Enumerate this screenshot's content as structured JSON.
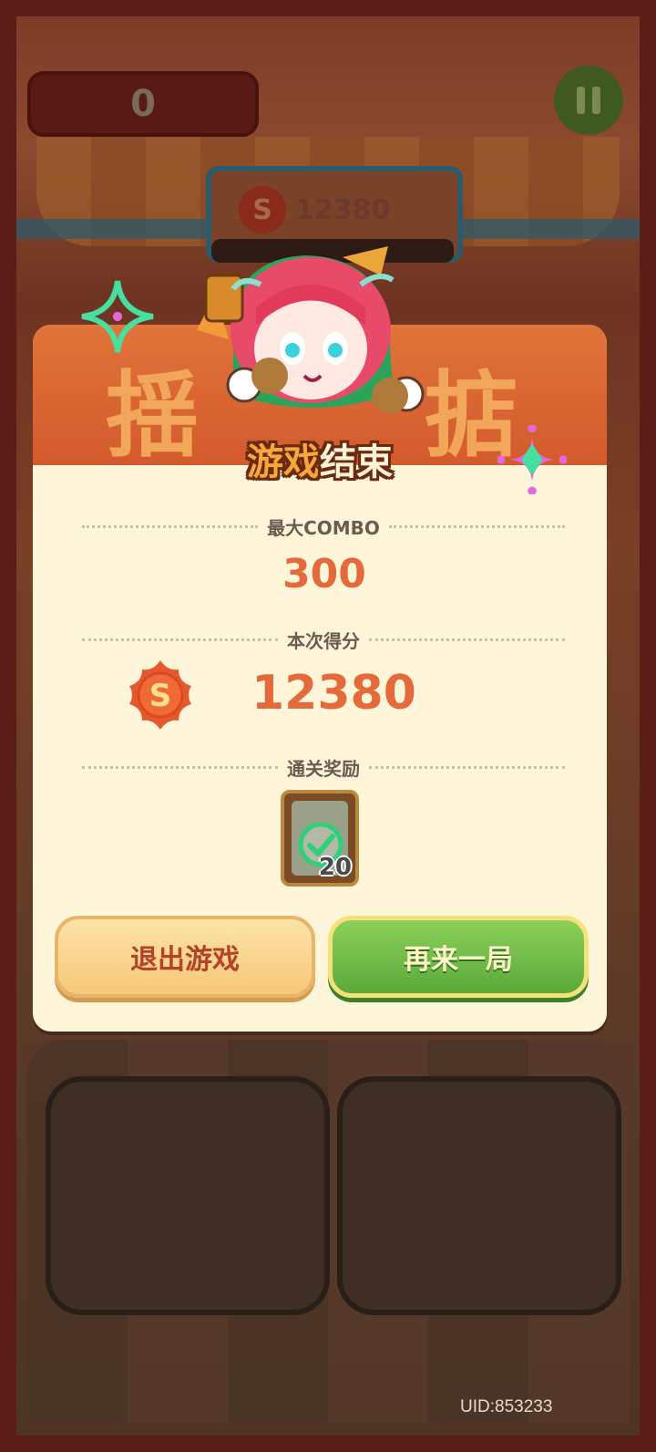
{
  "hud": {
    "score": "0",
    "sign_score": "12380"
  },
  "result": {
    "banner_word_left": "揺",
    "banner_word_right": "掂",
    "title_part1": "游戏",
    "title_part2": "结束",
    "combo_label": "最大COMBO",
    "combo_value": "300",
    "score_label": "本次得分",
    "coin_symbol": "S",
    "score_value": "12380",
    "reward_label": "通关奖励",
    "reward_count": "20",
    "exit_button": "退出游戏",
    "again_button": "再来一局"
  },
  "footer": {
    "uid": "UID:853233"
  },
  "colors": {
    "accent_orange": "#e46a3c",
    "header_orange": "#d35a2c",
    "card_cream": "#fff6da",
    "green_button": "#5ba93a"
  }
}
